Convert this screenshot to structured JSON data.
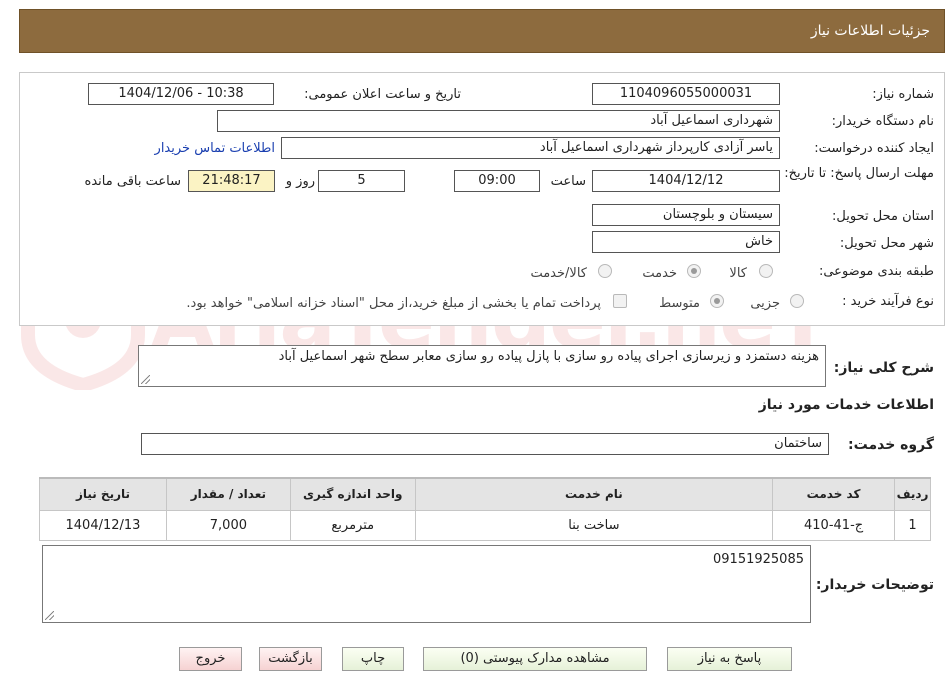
{
  "window": {
    "title": "جزئیات اطلاعات نیاز"
  },
  "form": {
    "need_number_label": "شماره نیاز:",
    "need_number": "1104096055000031",
    "announce_label": "تاریخ و ساعت اعلان عمومی:",
    "announce_value": "1404/12/06 - 10:38",
    "buyer_org_label": "نام دستگاه خریدار:",
    "buyer_org": "شهرداری اسماعیل آباد",
    "creator_label": "ایجاد کننده درخواست:",
    "creator": "یاسر آزادی کارپرداز شهرداری اسماعیل آباد",
    "contact_link": "اطلاعات تماس خریدار",
    "deadline_label": "مهلت ارسال پاسخ: تا تاریخ:",
    "deadline_date": "1404/12/12",
    "time_label": "ساعت",
    "deadline_time": "09:00",
    "days_value": "5",
    "days_label": "روز و",
    "remaining_time": "21:48:17",
    "remaining_label": "ساعت باقی مانده",
    "province_label": "استان محل تحویل:",
    "province": "سیستان و بلوچستان",
    "city_label": "شهر محل تحویل:",
    "city": "خاش",
    "category_label": "طبقه بندی موضوعی:",
    "category_options": [
      "کالا",
      "خدمت",
      "کالا/خدمت"
    ],
    "process_label": "نوع فرآیند خرید :",
    "process_options": [
      "جزیی",
      "متوسط"
    ],
    "payment_note": "پرداخت تمام یا بخشی از مبلغ خرید،از محل \"اسناد خزانه اسلامی\" خواهد بود."
  },
  "summary": {
    "label": "شرح کلی نیاز:",
    "text": "هزینه دستمزد و زیرسازی اجرای پیاده رو سازی با پازل پیاده رو سازی معابر سطح شهر اسماعیل آباد"
  },
  "services": {
    "section_title": "اطلاعات خدمات مورد نیاز",
    "group_label": "گروه خدمت:",
    "group_value": "ساختمان",
    "columns": [
      "ردیف",
      "کد خدمت",
      "نام خدمت",
      "واحد اندازه گیری",
      "تعداد / مقدار",
      "تاریخ نیاز"
    ],
    "rows": [
      {
        "row": "1",
        "code": "ج-41-410",
        "name": "ساخت بنا",
        "unit": "مترمربع",
        "qty": "7,000",
        "date": "1404/12/13"
      }
    ]
  },
  "buyer_notes": {
    "label": "توضیحات خریدار:",
    "text": "09151925085"
  },
  "buttons": {
    "reply": "پاسخ به نیاز",
    "attachments": "مشاهده مدارک پیوستی (0)",
    "print": "چاپ",
    "back": "بازگشت",
    "exit": "خروج"
  },
  "watermark_text": "AriaTender.neT",
  "colors": {
    "titlebar": "#8d6b3e",
    "link": "#1a3fb0",
    "timer_bg": "#fbf3c4"
  }
}
